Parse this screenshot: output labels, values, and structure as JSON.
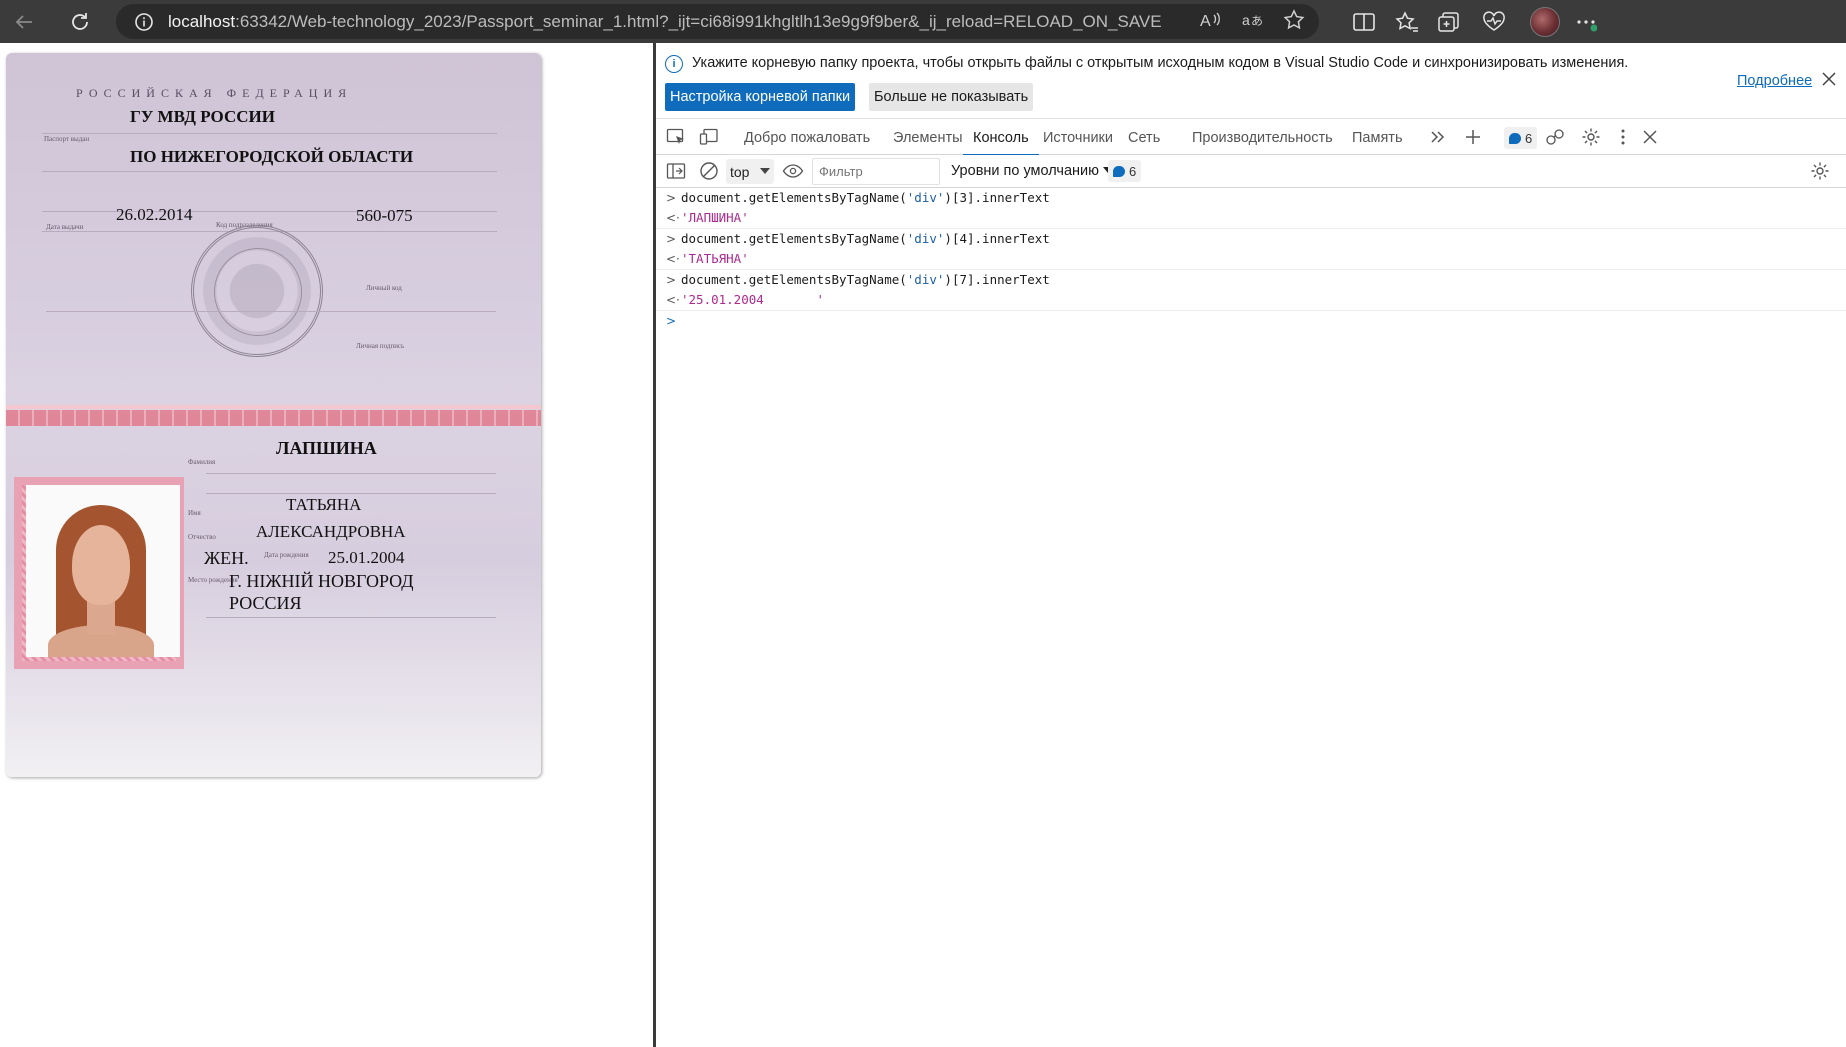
{
  "browser": {
    "url_host": "localhost",
    "url_rest": ":63342/Web-technology_2023/Passport_seminar_1.html?_ijt=ci68i991khgltlh13e9g9f9ber&_ij_reload=RELOAD_ON_SAVE"
  },
  "passport": {
    "country": "РОССИЙСКАЯ ФЕДЕРАЦИЯ",
    "issued_by_line1": "ГУ МВД РОССИИ",
    "issued_by_line2": "ПО НИЖЕГОРОДСКОЙ ОБЛАСТИ",
    "issue_date": "26.02.2014",
    "division_code": "560-075",
    "surname": "ЛАПШИНА",
    "name": "ТАТЬЯНА",
    "patronymic": "АЛЕКСАНДРОВНА",
    "sex": "ЖЕН.",
    "birth_date": "25.01.2004",
    "birth_place_line1": "Г. НІЖНІЙ НОВГОРОД",
    "birth_place_line2": "РОССИЯ"
  },
  "devtools": {
    "infobar": {
      "message": "Укажите корневую папку проекта, чтобы открыть файлы с открытым исходным кодом в Visual Studio Code и синхронизировать изменения.",
      "primary_button": "Настройка корневой папки",
      "secondary_button": "Больше не показывать",
      "link": "Подробнее"
    },
    "tabs": [
      {
        "label": "Добро пожаловать"
      },
      {
        "label": "Элементы"
      },
      {
        "label": "Консоль"
      },
      {
        "label": "Источники"
      },
      {
        "label": "Сеть"
      },
      {
        "label": "Производительность"
      },
      {
        "label": "Память"
      }
    ],
    "active_tab": "Консоль",
    "issues_count": "6",
    "console_toolbar": {
      "context": "top",
      "filter_placeholder": "Фильтр",
      "levels": "Уровни по умолчанию",
      "messages_count": "6"
    },
    "console": [
      {
        "input_prefix": "document.getElementsByTagName(",
        "input_arg": "'div'",
        "input_suffix": ")[3].innerText",
        "output": "'ЛАПШИНА'"
      },
      {
        "input_prefix": "document.getElementsByTagName(",
        "input_arg": "'div'",
        "input_suffix": ")[4].innerText",
        "output": "'ТАТЬЯНА'"
      },
      {
        "input_prefix": "document.getElementsByTagName(",
        "input_arg": "'div'",
        "input_suffix": ")[7].innerText",
        "output": "'25.01.2004       '"
      }
    ]
  },
  "colors": {
    "accent": "#0f6cbd",
    "toolbar_bg": "#3b3b3b",
    "console_string": "#ac2a90"
  }
}
